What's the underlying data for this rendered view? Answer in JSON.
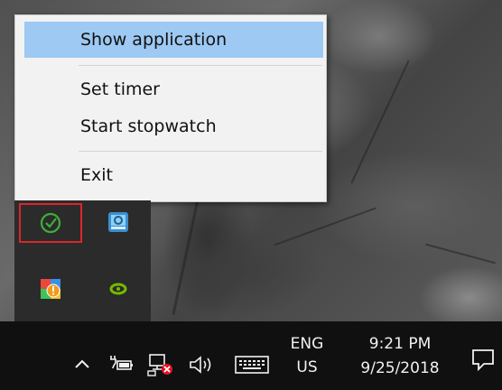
{
  "context_menu": {
    "items": [
      {
        "label": "Show application",
        "highlighted": true
      },
      {
        "label": "Set timer"
      },
      {
        "label": "Start stopwatch"
      },
      {
        "label": "Exit"
      }
    ]
  },
  "tray_flyout": {
    "icons": [
      "stopwatch-icon",
      "sync-app-icon",
      "alert-app-icon",
      "nvidia-icon"
    ],
    "highlight_color": "#d9262b"
  },
  "taskbar": {
    "icons": [
      "chevron-up-icon",
      "power-battery-icon",
      "network-disconnected-icon",
      "volume-icon",
      "touch-keyboard-icon",
      "notification-center-icon"
    ],
    "language": {
      "code": "ENG",
      "region": "US"
    },
    "clock": {
      "time": "9:21 PM",
      "date": "9/25/2018"
    }
  }
}
